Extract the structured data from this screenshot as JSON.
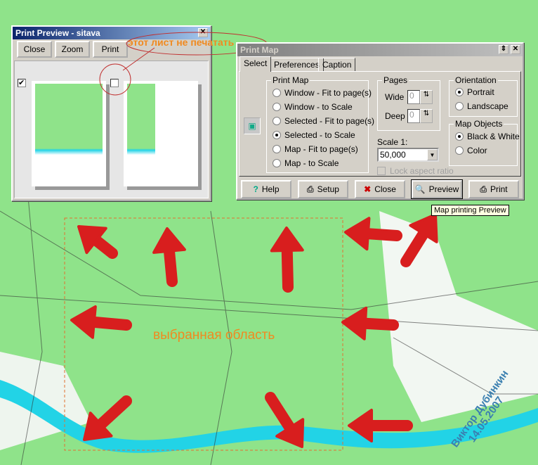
{
  "print_preview": {
    "title": "Print Preview - sitava",
    "buttons": [
      "Close",
      "Zoom",
      "Print"
    ],
    "pages": [
      {
        "checked": true
      },
      {
        "checked": false
      }
    ]
  },
  "print_map": {
    "title": "Print Map",
    "tabs": [
      "Select",
      "Preferences",
      "Caption"
    ],
    "active_tab": "Select",
    "print_map_group": {
      "label": "Print Map",
      "options": [
        "Window - Fit to page(s)",
        "Window - to Scale",
        "Selected - Fit to page(s)",
        "Selected - to Scale",
        "Map - Fit to page(s)",
        "Map - to Scale"
      ],
      "selected": "Selected - to Scale"
    },
    "pages": {
      "label": "Pages",
      "wide_label": "Wide",
      "wide": "0",
      "deep_label": "Deep",
      "deep": "0"
    },
    "scale": {
      "label": "Scale 1:",
      "value": "50,000"
    },
    "lock_aspect": {
      "label": "Lock aspect ratio",
      "checked": false,
      "enabled": false
    },
    "orientation": {
      "label": "Orientation",
      "options": [
        "Portrait",
        "Landscape"
      ],
      "selected": "Portrait"
    },
    "map_objects": {
      "label": "Map Objects",
      "options": [
        "Black & White",
        "Color"
      ],
      "selected": "Black & White"
    },
    "buttons": [
      "Help",
      "Setup",
      "Close",
      "Preview",
      "Print"
    ]
  },
  "tooltip": "Map printing Preview",
  "annotations": {
    "no_print": "этот лист не печатать",
    "selected_area": "выбранная область",
    "signature": "Виктор Дубинкин",
    "date": "14.05.2007"
  },
  "colors": {
    "map_green": "#8fe38a",
    "river": "#22d3e6",
    "arrow": "#d81e1e",
    "annotation": "#f08a20"
  }
}
